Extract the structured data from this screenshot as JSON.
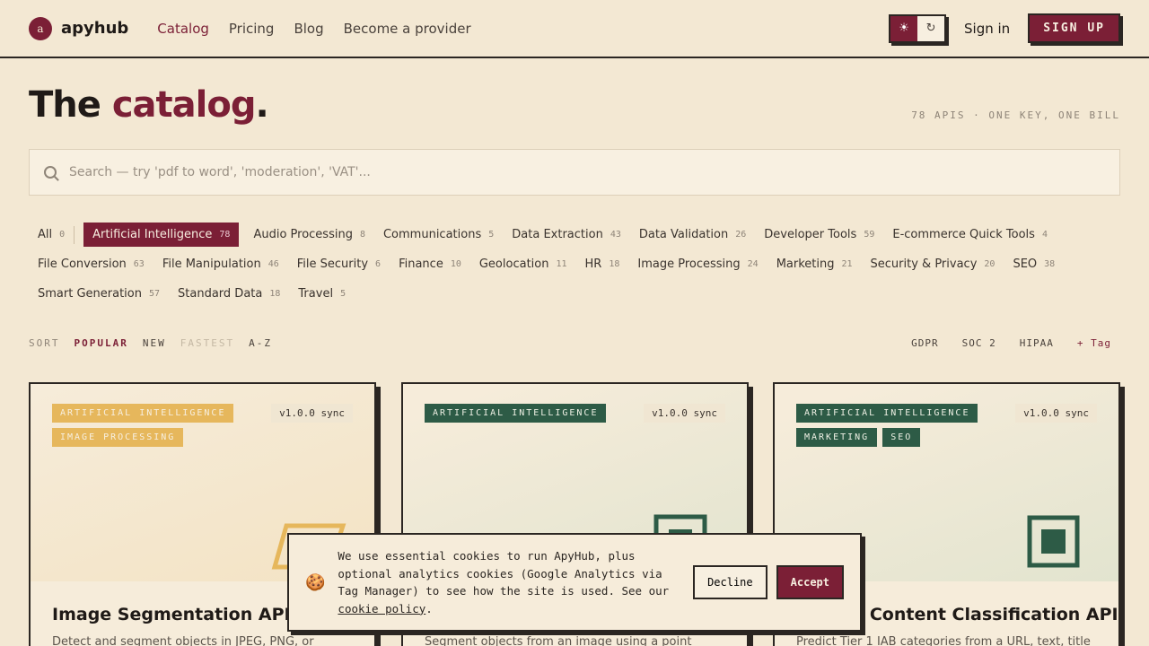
{
  "brand": {
    "logo_letter": "a",
    "name": "apyhub"
  },
  "nav": [
    {
      "label": "Catalog",
      "active": true
    },
    {
      "label": "Pricing"
    },
    {
      "label": "Blog"
    },
    {
      "label": "Become a provider"
    }
  ],
  "header": {
    "theme_light_icon": "sun-icon",
    "theme_auto_icon": "refresh-icon",
    "sign_in": "Sign in",
    "sign_up": "SIGN UP"
  },
  "page": {
    "title_start": "The",
    "title_accent": "catalog",
    "title_end": ".",
    "meta": "78 APIS · ONE KEY, ONE BILL"
  },
  "search": {
    "placeholder": "Search — try 'pdf to word', 'moderation', 'VAT'..."
  },
  "filters": {
    "row1": [
      {
        "label": "All",
        "count": "0"
      },
      {
        "label": "Artificial Intelligence",
        "count": "78",
        "active": true
      },
      {
        "label": "Audio Processing",
        "count": "8"
      },
      {
        "label": "Communications",
        "count": "5"
      },
      {
        "label": "Data Extraction",
        "count": "43"
      },
      {
        "label": "Data Validation",
        "count": "26"
      },
      {
        "label": "Developer Tools",
        "count": "59"
      },
      {
        "label": "E-commerce Quick Tools",
        "count": "4"
      }
    ],
    "row2": [
      {
        "label": "File Conversion",
        "count": "63"
      },
      {
        "label": "File Manipulation",
        "count": "46"
      },
      {
        "label": "File Security",
        "count": "6"
      },
      {
        "label": "Finance",
        "count": "10"
      },
      {
        "label": "Geolocation",
        "count": "11"
      },
      {
        "label": "HR",
        "count": "18"
      },
      {
        "label": "Image Processing",
        "count": "24"
      },
      {
        "label": "Marketing",
        "count": "21"
      },
      {
        "label": "Security & Privacy",
        "count": "20"
      },
      {
        "label": "SEO",
        "count": "38"
      }
    ],
    "row3": [
      {
        "label": "Smart Generation",
        "count": "57"
      },
      {
        "label": "Standard Data",
        "count": "18"
      },
      {
        "label": "Travel",
        "count": "5"
      }
    ]
  },
  "sort": {
    "label": "SORT",
    "options": [
      "POPULAR",
      "NEW",
      "FASTEST",
      "A-Z"
    ],
    "active": "POPULAR"
  },
  "tags": [
    "GDPR",
    "SOC 2",
    "HIPAA",
    "+ Tag"
  ],
  "cards": [
    {
      "badges": [
        "ARTIFICIAL INTELLIGENCE",
        "IMAGE PROCESSING"
      ],
      "badge_color": "#e6b75c",
      "version": "v1.0.0  sync",
      "title": "Image Segmentation API",
      "desc": "Detect and segment objects in JPEG, PNG, or"
    },
    {
      "badges": [
        "ARTIFICIAL INTELLIGENCE"
      ],
      "badge_color": "#2d5b46",
      "version": "v1.0.0  sync",
      "title": "",
      "desc": "Segment objects from an image using a point"
    },
    {
      "badges": [
        "ARTIFICIAL INTELLIGENCE",
        "MARKETING",
        "SEO"
      ],
      "badge_color": "#2d5b46",
      "version": "v1.0.0  sync",
      "title": "1 Content Classification API",
      "desc": "Predict Tier 1 IAB categories from a URL, text, title"
    }
  ],
  "cookie": {
    "text": "We use essential cookies to run ApyHub, plus optional analytics cookies (Google Analytics via Tag Manager) to see how the site is used. See our",
    "link": "cookie policy",
    "end": ".",
    "decline": "Decline",
    "accept": "Accept"
  },
  "colors": {
    "accent": "#7b1f36",
    "background": "#f3e8d3",
    "green": "#2d5b46",
    "yellow": "#e6b75c"
  }
}
